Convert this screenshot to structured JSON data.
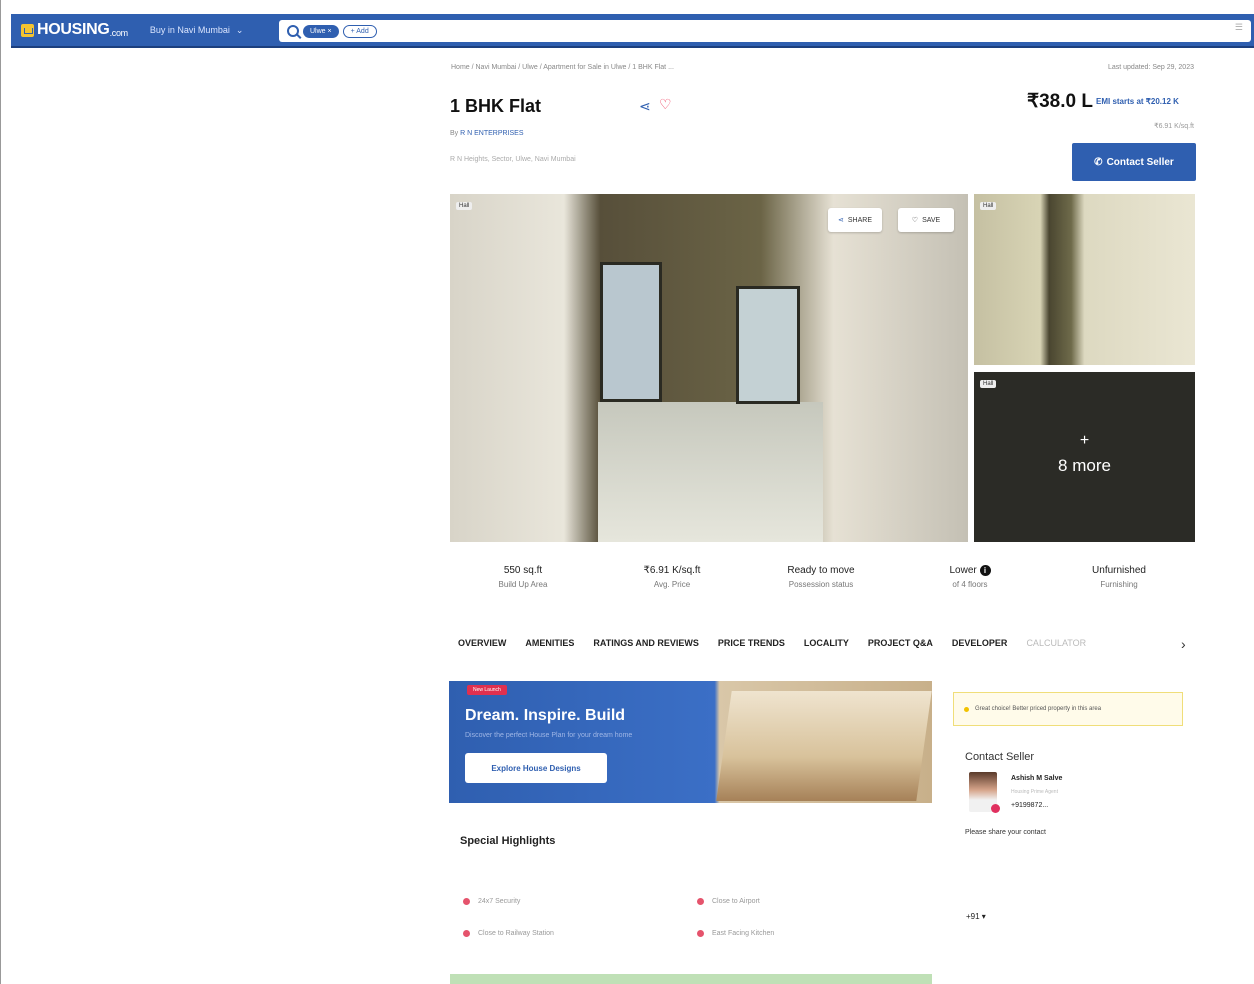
{
  "header": {
    "logo_text": "HOUSING",
    "logo_suffix": ".com",
    "city": "Buy in Navi Mumbai",
    "chip": "Ulwe",
    "add_label": "+ Add"
  },
  "listing": {
    "breadcrumb": "Home / Navi Mumbai / Ulwe / Apartment for Sale in Ulwe / 1 BHK Flat ...",
    "updated": "Last updated: Sep 29, 2023",
    "title": "1 BHK Flat",
    "price": "₹38.0 L",
    "emi": "EMI starts at ₹20.12 K",
    "price_per_sqft": "₹6.91 K/sq.ft",
    "by_prefix": "By ",
    "developer": "R N ENTERPRISES",
    "address": "R N Heights, Sector, Ulwe, Navi Mumbai",
    "contact_button": "Contact Seller"
  },
  "photos": {
    "share": "SHARE",
    "save": "SAVE",
    "tag": "Hall",
    "more_plus": "+",
    "more_text": "8 more"
  },
  "stats": [
    {
      "value": "550 sq.ft",
      "label": "Build Up Area"
    },
    {
      "value": "₹6.91 K/sq.ft",
      "label": "Avg. Price"
    },
    {
      "value": "Ready to move",
      "label": "Possession status"
    },
    {
      "value": "Lower",
      "label": "of 4 floors"
    },
    {
      "value": "Unfurnished",
      "label": "Furnishing"
    }
  ],
  "tabs": [
    "OVERVIEW",
    "AMENITIES",
    "RATINGS AND REVIEWS",
    "PRICE TRENDS",
    "LOCALITY",
    "PROJECT Q&A",
    "DEVELOPER",
    "CALCULATOR"
  ],
  "banner": {
    "badge": "New Launch",
    "title": "Dream. Inspire. Build",
    "subtitle": "Discover the perfect House Plan for your dream home",
    "button": "Explore House Designs"
  },
  "highlights": {
    "title": "Special Highlights",
    "items": [
      "24x7 Security",
      "Close to Airport",
      "Close to Railway Station",
      "East Facing Kitchen"
    ]
  },
  "sidebar": {
    "alert": "Great choice! Better priced property in this area",
    "contact_title": "Contact Seller",
    "agent_name": "Ashish M Salve",
    "agent_role": "Housing Prime Agent",
    "agent_phone": "+9199872...",
    "share_contact": "Please share your contact",
    "phone_code": "+91 ▾"
  }
}
